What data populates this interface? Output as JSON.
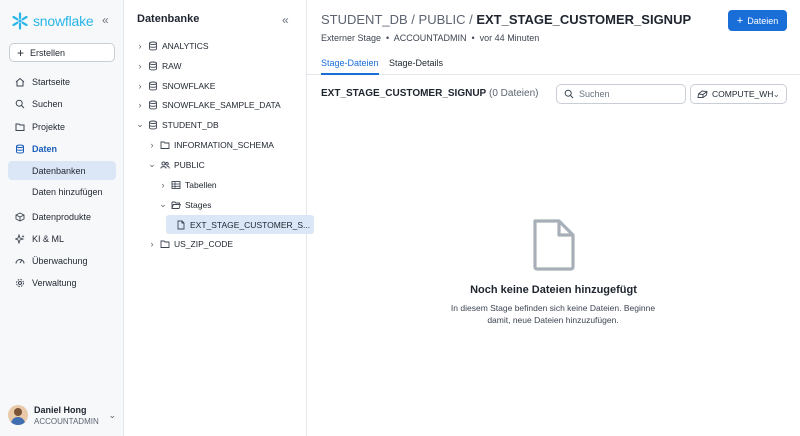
{
  "brand": {
    "name": "snowflake",
    "accent": "#29b5e8"
  },
  "nav": {
    "collapse_label": "«",
    "create_label": "Erstellen",
    "items": [
      {
        "label": "Startseite",
        "icon": "home-icon"
      },
      {
        "label": "Suchen",
        "icon": "search-icon"
      },
      {
        "label": "Projekte",
        "icon": "folder-icon"
      },
      {
        "label": "Daten",
        "icon": "database-icon",
        "active": true
      },
      {
        "label": "Datenprodukte",
        "icon": "cube-icon"
      },
      {
        "label": "KI & ML",
        "icon": "ai-icon"
      },
      {
        "label": "Überwachung",
        "icon": "gauge-icon"
      },
      {
        "label": "Verwaltung",
        "icon": "gear-icon"
      }
    ],
    "sub_items": [
      {
        "label": "Datenbanken",
        "selected": true
      },
      {
        "label": "Daten hinzufügen"
      }
    ],
    "user": {
      "name": "Daniel Hong",
      "role": "ACCOUNTADMIN"
    }
  },
  "tree": {
    "title": "Datenbanke",
    "collapse_label": "«",
    "rows": [
      {
        "label": "ANALYTICS",
        "chev": "›",
        "icon": "database-icon"
      },
      {
        "label": "RAW",
        "chev": "›",
        "icon": "database-icon"
      },
      {
        "label": "SNOWFLAKE",
        "chev": "›",
        "icon": "database-icon"
      },
      {
        "label": "SNOWFLAKE_SAMPLE_DATA",
        "chev": "›",
        "icon": "database-icon"
      },
      {
        "label": "STUDENT_DB",
        "chev": "⌄",
        "icon": "database-icon"
      },
      {
        "label": "INFORMATION_SCHEMA",
        "chev": "›",
        "icon": "folder-icon"
      },
      {
        "label": "PUBLIC",
        "chev": "⌄",
        "icon": "users-icon"
      },
      {
        "label": "Tabellen",
        "chev": "›",
        "icon": "table-icon"
      },
      {
        "label": "Stages",
        "chev": "⌄",
        "icon": "folder-open-icon"
      },
      {
        "label": "EXT_STAGE_CUSTOMER_S...",
        "chev": "",
        "icon": "file-icon",
        "selected": true
      },
      {
        "label": "US_ZIP_CODE",
        "chev": "›",
        "icon": "folder-icon"
      }
    ]
  },
  "main": {
    "breadcrumb": {
      "db": "STUDENT_DB",
      "sep": " / ",
      "schema": "PUBLIC",
      "object": "EXT_STAGE_CUSTOMER_SIGNUP"
    },
    "subtitle": "Externer Stage  •  ACCOUNTADMIN  •  vor 44 Minuten",
    "add_files_label": "Dateien",
    "tabs": [
      {
        "label": "Stage-Dateien",
        "active": true
      },
      {
        "label": "Stage-Details"
      }
    ],
    "section": {
      "name": "EXT_STAGE_CUSTOMER_SIGNUP",
      "count": "(0 Dateien)"
    },
    "search": {
      "placeholder": "Suchen",
      "value": ""
    },
    "warehouse": "COMPUTE_WH",
    "empty": {
      "title": "Noch keine Dateien hinzugefügt",
      "text": "In diesem Stage befinden sich keine Dateien. Beginne damit, neue Dateien hinzuzufügen."
    }
  }
}
